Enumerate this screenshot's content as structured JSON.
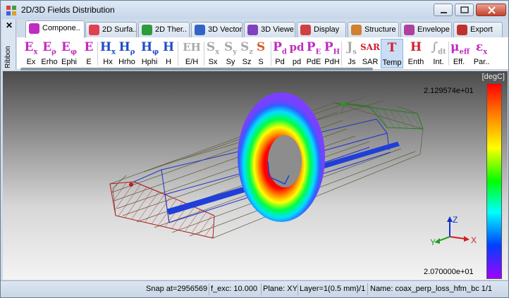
{
  "window": {
    "title": "2D/3D Fields Distribution"
  },
  "ribbon": {
    "label": "Ribbon"
  },
  "tabs": [
    {
      "label": "Compone..",
      "color": "#c02bc0"
    },
    {
      "label": "2D Surfa..",
      "color": "#e04050"
    },
    {
      "label": "2D Ther..",
      "color": "#2a9d3a"
    },
    {
      "label": "3D Vector",
      "color": "#3264c8"
    },
    {
      "label": "3D Viewe",
      "color": "#8040c0"
    },
    {
      "label": "Display",
      "color": "#d04040"
    },
    {
      "label": "Structure",
      "color": "#d08030"
    },
    {
      "label": "Envelope",
      "color": "#b040a0"
    },
    {
      "label": "Export",
      "color": "#c03030"
    }
  ],
  "tools": [
    {
      "glyph": "E",
      "sub": "x",
      "label": "Ex",
      "color": "#c02bc0"
    },
    {
      "glyph": "E",
      "sub": "ρ",
      "label": "Erho",
      "color": "#c02bc0"
    },
    {
      "glyph": "E",
      "sub": "φ",
      "label": "Ephi",
      "color": "#c02bc0"
    },
    {
      "glyph": "E",
      "sub": "",
      "label": "E",
      "color": "#c02bc0"
    },
    {
      "glyph": "H",
      "sub": "x",
      "label": "Hx",
      "color": "#1e4bc8"
    },
    {
      "glyph": "H",
      "sub": "ρ",
      "label": "Hrho",
      "color": "#1e4bc8"
    },
    {
      "glyph": "H",
      "sub": "φ",
      "label": "Hphi",
      "color": "#1e4bc8"
    },
    {
      "glyph": "H",
      "sub": "",
      "label": "H",
      "color": "#1e4bc8"
    },
    {
      "glyph": "EH",
      "sub": "",
      "label": "E/H",
      "color": "#a8a8a8"
    },
    {
      "glyph": "S",
      "sub": "x",
      "label": "Sx",
      "color": "#a8a8a8"
    },
    {
      "glyph": "S",
      "sub": "y",
      "label": "Sy",
      "color": "#a8a8a8"
    },
    {
      "glyph": "S",
      "sub": "z",
      "label": "Sz",
      "color": "#a8a8a8"
    },
    {
      "glyph": "S",
      "sub": "",
      "label": "S",
      "color": "#d06030"
    },
    {
      "glyph": "P",
      "sub": "d",
      "label": "Pd",
      "color": "#c02bc0"
    },
    {
      "glyph": "pd",
      "sub": "",
      "label": "pd",
      "color": "#c02bc0"
    },
    {
      "glyph": "P",
      "sub": "E",
      "label": "PdE",
      "color": "#c02bc0"
    },
    {
      "glyph": "P",
      "sub": "H",
      "label": "PdH",
      "color": "#c02bc0"
    },
    {
      "glyph": "J",
      "sub": "s",
      "label": "Js",
      "color": "#a8a8a8"
    },
    {
      "glyph": "SAR",
      "sub": "",
      "label": "SAR",
      "color": "#d02030"
    },
    {
      "glyph": "T",
      "sub": "",
      "label": "Temp",
      "color": "#d02030"
    },
    {
      "glyph": "H",
      "sub": "",
      "label": "Enth",
      "color": "#d02030"
    },
    {
      "glyph": "∫",
      "sub": "dt",
      "label": "Int.",
      "color": "#a8a8a8"
    },
    {
      "glyph": "μ",
      "sub": "eff",
      "label": "Eff.",
      "color": "#c02bc0"
    },
    {
      "glyph": "ε",
      "sub": "x",
      "label": "Par..",
      "color": "#c02bc0"
    }
  ],
  "viewport": {
    "unit": "[degC]",
    "max_value": "2.129574e+01",
    "min_value": "2.070000e+01",
    "axes": {
      "x": "X",
      "y": "Y",
      "z": "Z"
    }
  },
  "status": {
    "snap": "Snap at=2956569",
    "fexc": "f_exc: 10.000",
    "plane": "Plane: XY",
    "layer": "Layer=1(0.5 mm)/1",
    "name": "Name: coax_perp_loss_hfm_bc 1/1"
  }
}
